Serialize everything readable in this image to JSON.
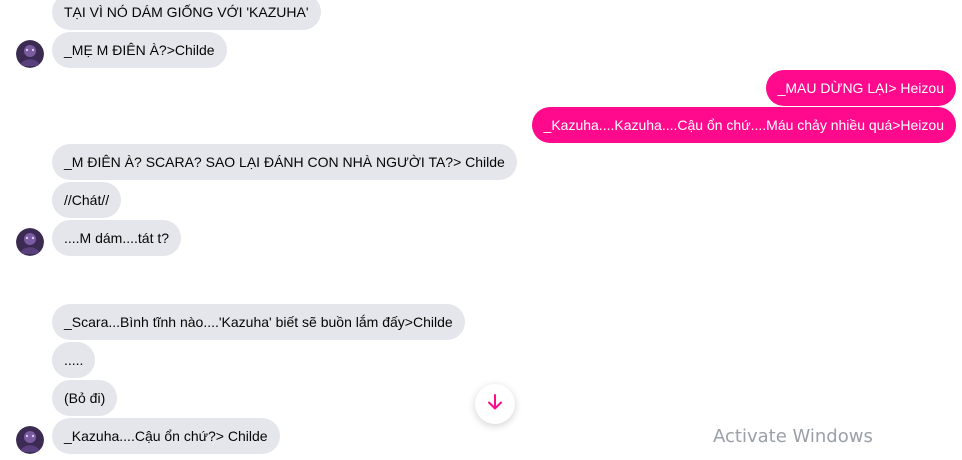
{
  "messages": {
    "m1": "TẠI VÌ NÓ DÁM GIỐNG VỚI 'KAZUHA'",
    "m2": "_MẸ M ĐIÊN À?>Childe",
    "m3": "_MAU DỪNG LẠI> Heizou",
    "m4": "_Kazuha....Kazuha....Cậu ổn chứ....Máu chảy nhiều quá>Heizou",
    "m5": "_M ĐIÊN À? SCARA? SAO LẠI ĐÁNH CON NHÀ NGƯỜI TA?> Childe",
    "m6": "//Chát//",
    "m7": "....M dám....tát t?",
    "m8": "_Scara...Bình tĩnh nào....'Kazuha' biết sẽ buồn lắm đấy>Childe",
    "m9": ".....",
    "m10": "(Bỏ đi)",
    "m11": "_Kazuha....Cậu ổn chứ?> Childe"
  },
  "overlay": {
    "watermark": "Activate Windows"
  },
  "icons": {
    "avatar": "avatar-icon",
    "scroll": "arrow-down-icon"
  },
  "colors": {
    "incoming_bubble": "#e4e6eb",
    "outgoing_bubble": "#ff0a8c",
    "accent": "#ff0a8c"
  }
}
